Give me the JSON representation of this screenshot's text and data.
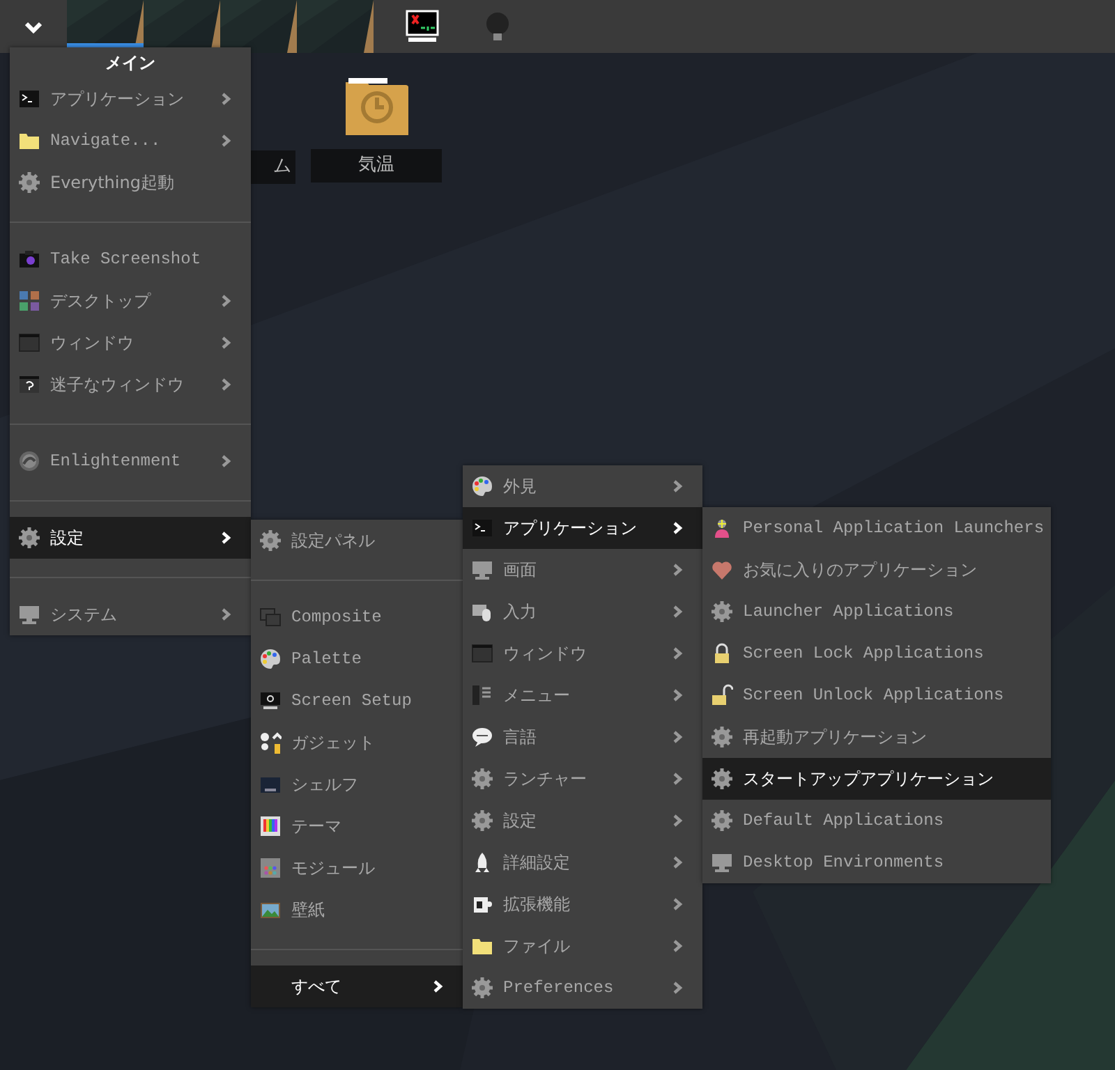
{
  "taskbar": {
    "desks": [
      {
        "selected": true
      },
      {
        "selected": false
      },
      {
        "selected": false
      },
      {
        "selected": false
      }
    ]
  },
  "desktop_icons": [
    {
      "label": "ム"
    },
    {
      "label": "気温"
    }
  ],
  "menus": [
    {
      "title": "メイン",
      "items": [
        {
          "kind": "item",
          "label": "アプリケーション",
          "submenu": true,
          "selected": false
        },
        {
          "kind": "item",
          "label": "Navigate...",
          "submenu": true,
          "selected": false
        },
        {
          "kind": "item",
          "label": "Everything起動",
          "submenu": false,
          "selected": false
        },
        {
          "kind": "separator"
        },
        {
          "kind": "item",
          "label": "Take Screenshot",
          "submenu": false,
          "selected": false
        },
        {
          "kind": "item",
          "label": "デスクトップ",
          "submenu": true,
          "selected": false
        },
        {
          "kind": "item",
          "label": "ウィンドウ",
          "submenu": true,
          "selected": false
        },
        {
          "kind": "item",
          "label": "迷子なウィンドウ",
          "submenu": true,
          "selected": false
        },
        {
          "kind": "separator"
        },
        {
          "kind": "item",
          "label": "Enlightenment",
          "submenu": true,
          "selected": false
        },
        {
          "kind": "separator"
        },
        {
          "kind": "item",
          "label": "設定",
          "submenu": true,
          "selected": true
        },
        {
          "kind": "separator"
        },
        {
          "kind": "item",
          "label": "システム",
          "submenu": true,
          "selected": false
        }
      ]
    },
    {
      "items": [
        {
          "kind": "item",
          "label": "設定パネル",
          "submenu": false,
          "selected": false
        },
        {
          "kind": "separator"
        },
        {
          "kind": "item",
          "label": "Composite",
          "submenu": false,
          "selected": false
        },
        {
          "kind": "item",
          "label": "Palette",
          "submenu": false,
          "selected": false
        },
        {
          "kind": "item",
          "label": "Screen Setup",
          "submenu": false,
          "selected": false
        },
        {
          "kind": "item",
          "label": "ガジェット",
          "submenu": false,
          "selected": false
        },
        {
          "kind": "item",
          "label": "シェルフ",
          "submenu": false,
          "selected": false
        },
        {
          "kind": "item",
          "label": "テーマ",
          "submenu": false,
          "selected": false
        },
        {
          "kind": "item",
          "label": "モジュール",
          "submenu": false,
          "selected": false
        },
        {
          "kind": "item",
          "label": "壁紙",
          "submenu": false,
          "selected": false
        },
        {
          "kind": "separator"
        },
        {
          "kind": "item",
          "label": "すべて",
          "submenu": true,
          "selected": true
        }
      ]
    },
    {
      "items": [
        {
          "kind": "item",
          "label": "外見",
          "submenu": true,
          "selected": false
        },
        {
          "kind": "item",
          "label": "アプリケーション",
          "submenu": true,
          "selected": true
        },
        {
          "kind": "item",
          "label": "画面",
          "submenu": true,
          "selected": false
        },
        {
          "kind": "item",
          "label": "入力",
          "submenu": true,
          "selected": false
        },
        {
          "kind": "item",
          "label": "ウィンドウ",
          "submenu": true,
          "selected": false
        },
        {
          "kind": "item",
          "label": "メニュー",
          "submenu": true,
          "selected": false
        },
        {
          "kind": "item",
          "label": "言語",
          "submenu": true,
          "selected": false
        },
        {
          "kind": "item",
          "label": "ランチャー",
          "submenu": true,
          "selected": false
        },
        {
          "kind": "item",
          "label": "設定",
          "submenu": true,
          "selected": false
        },
        {
          "kind": "item",
          "label": "詳細設定",
          "submenu": true,
          "selected": false
        },
        {
          "kind": "item",
          "label": "拡張機能",
          "submenu": true,
          "selected": false
        },
        {
          "kind": "item",
          "label": "ファイル",
          "submenu": true,
          "selected": false
        },
        {
          "kind": "item",
          "label": "Preferences",
          "submenu": true,
          "selected": false
        }
      ]
    },
    {
      "items": [
        {
          "kind": "item",
          "label": "Personal Application Launchers",
          "submenu": false,
          "selected": false
        },
        {
          "kind": "item",
          "label": "お気に入りのアプリケーション",
          "submenu": false,
          "selected": false
        },
        {
          "kind": "item",
          "label": "Launcher Applications",
          "submenu": false,
          "selected": false
        },
        {
          "kind": "item",
          "label": "Screen Lock Applications",
          "submenu": false,
          "selected": false
        },
        {
          "kind": "item",
          "label": "Screen Unlock Applications",
          "submenu": false,
          "selected": false
        },
        {
          "kind": "item",
          "label": "再起動アプリケーション",
          "submenu": false,
          "selected": false
        },
        {
          "kind": "item",
          "label": "スタートアップアプリケーション",
          "submenu": false,
          "selected": true
        },
        {
          "kind": "item",
          "label": "Default Applications",
          "submenu": false,
          "selected": false
        },
        {
          "kind": "item",
          "label": "Desktop Environments",
          "submenu": false,
          "selected": false
        }
      ]
    }
  ]
}
